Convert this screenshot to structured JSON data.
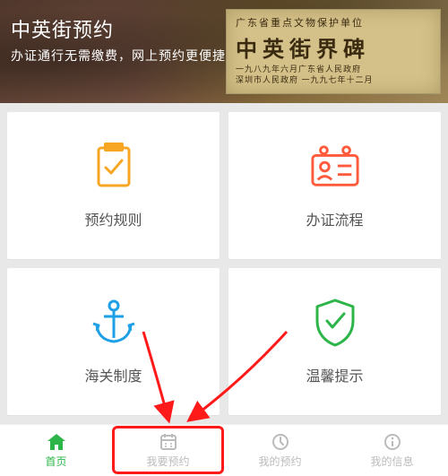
{
  "hero": {
    "title": "中英街预约",
    "subtitle": "办证通行无需缴费，网上预约更便捷",
    "stone_top": "广东省重点文物保护单位",
    "stone_main": "中英街界碑",
    "stone_line1": "一九八九年六月广东省人民政府",
    "stone_line2": "深圳市人民政府 一九九七年十二月"
  },
  "cards": {
    "rules": "预约规则",
    "process": "办证流程",
    "customs": "海关制度",
    "tips": "温馨提示"
  },
  "tabs": {
    "home": "首页",
    "book": "我要预约",
    "my_book": "我的预约",
    "my_info": "我的信息"
  }
}
